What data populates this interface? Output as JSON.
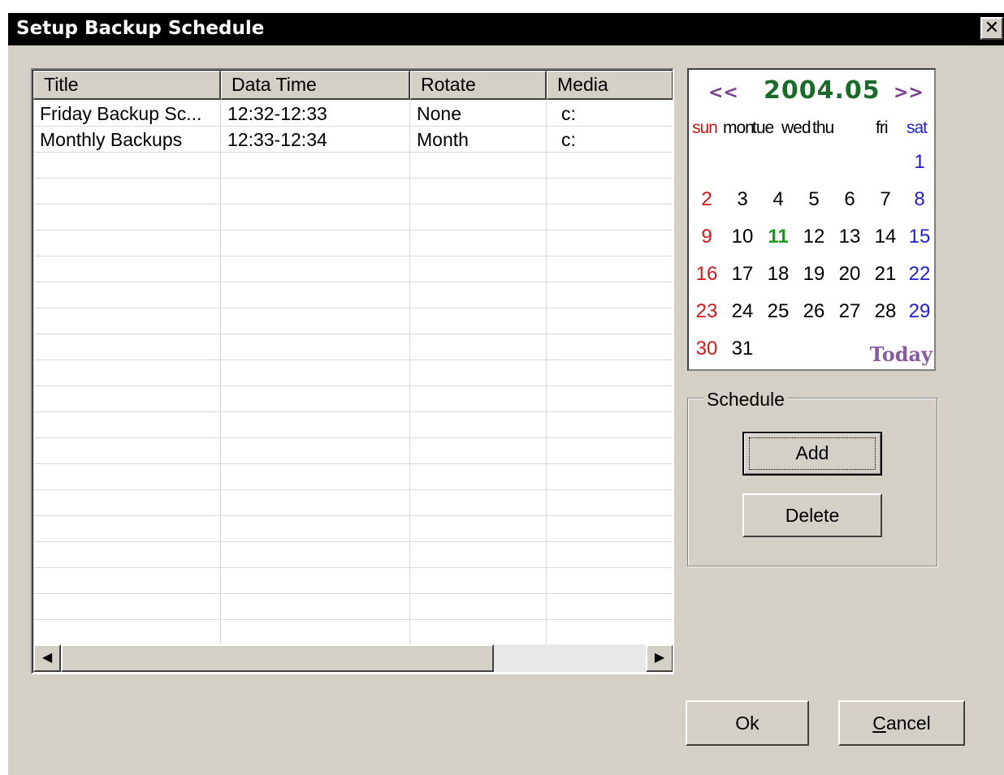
{
  "window": {
    "title": "Setup Backup Schedule",
    "close_glyph": "✕"
  },
  "list": {
    "columns": [
      "Title",
      "Data Time",
      "Rotate",
      "Media"
    ],
    "rows": [
      [
        "Friday Backup Sc...",
        "12:32-12:33",
        "None",
        "c:"
      ],
      [
        "Monthly Backups",
        "12:33-12:34",
        "Month",
        "c:"
      ]
    ]
  },
  "scrollbar": {
    "left_arrow": "◀",
    "right_arrow": "▶"
  },
  "calendar": {
    "prev": "<<",
    "next": ">>",
    "month_label": "2004.05",
    "weekdays": [
      "sun",
      "mon",
      "tue",
      "wed",
      "thu",
      "fri",
      "sat"
    ],
    "first_weekday_index": 6,
    "days_in_month": 31,
    "highlighted_day": 11,
    "today_label": "Today",
    "colors": {
      "sunday": "#d01818",
      "saturday": "#2020d0",
      "highlight": "#10a010"
    }
  },
  "schedule": {
    "group_label": "Schedule",
    "add_label": "Add",
    "delete_label": "Delete"
  },
  "footer": {
    "ok_label": "Ok",
    "cancel_label": "Cancel"
  }
}
